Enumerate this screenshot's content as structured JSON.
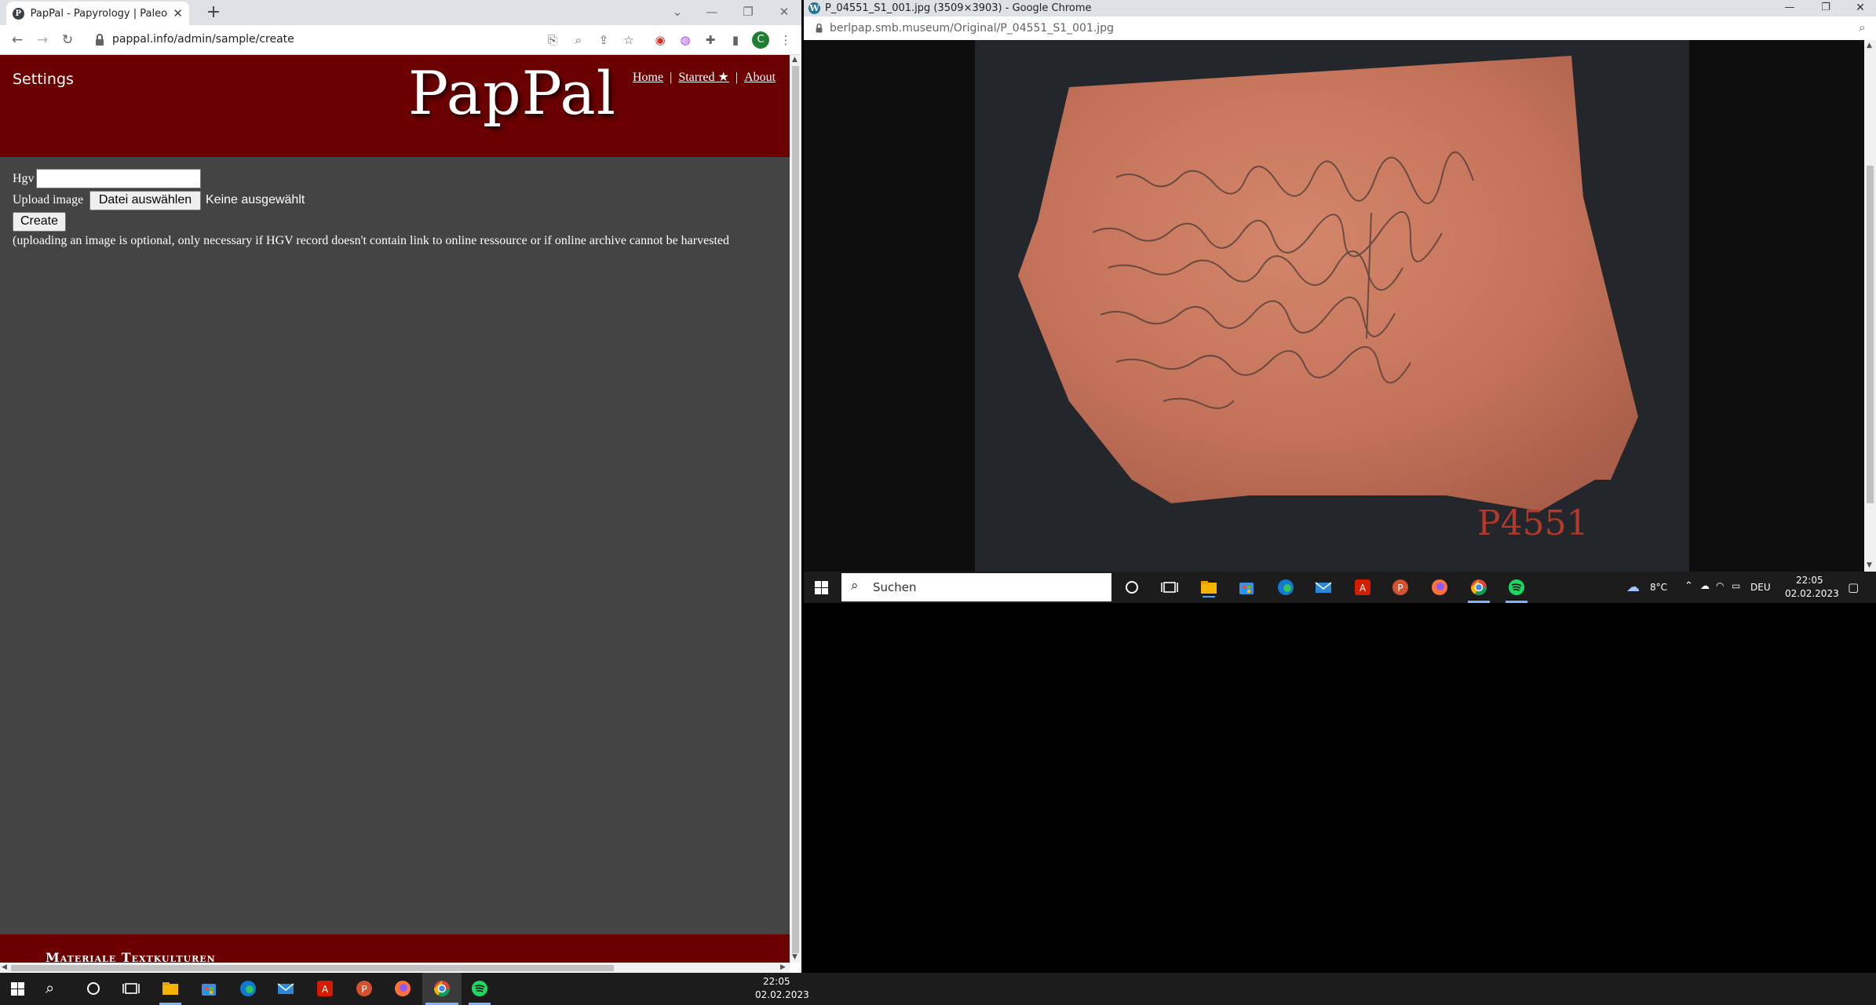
{
  "left_window": {
    "tab_favicon": "P",
    "tab_title": "PapPal - Papyrology | Paleography",
    "url": "pappal.info/admin/sample/create",
    "profile_initial": "C"
  },
  "page": {
    "settings_label": "Settings",
    "logo": "PapPal",
    "nav": {
      "home": "Home",
      "starred": "Starred ★",
      "about": "About",
      "separator": "|"
    },
    "form": {
      "hgv_label": "Hgv",
      "hgv_value": "",
      "upload_label": "Upload image",
      "file_button": "Datei auswählen",
      "file_status": "Keine ausgewählt",
      "create_button": "Create",
      "note": "(uploading an image is optional, only necessary if HGV record doesn't contain link to online ressource or if online archive cannot be harvested"
    },
    "footer_text": "Materiale Textkulturen"
  },
  "right_window": {
    "title": "P_04551_S1_001.jpg (3509×3903) - Google Chrome",
    "url": "berlpap.smb.museum/Original/P_04551_S1_001.jpg",
    "specimen_label": "P4551"
  },
  "inner_taskbar": {
    "search_placeholder": "Suchen",
    "weather": "8°C",
    "language": "DEU",
    "time": "22:05",
    "date": "02.02.2023"
  },
  "taskbar": {
    "time": "22:05",
    "date": "02.02.2023"
  },
  "colors": {
    "header_bg": "#6b0000",
    "page_bg": "#444444",
    "shard": "#c8765a"
  },
  "icons": [
    "windows-start-icon",
    "search-icon",
    "cortana-icon",
    "task-view-icon",
    "file-explorer-icon",
    "store-icon",
    "edge-icon",
    "mail-icon",
    "acrobat-icon",
    "powerpoint-icon",
    "firefox-icon",
    "chrome-icon",
    "spotify-icon"
  ]
}
